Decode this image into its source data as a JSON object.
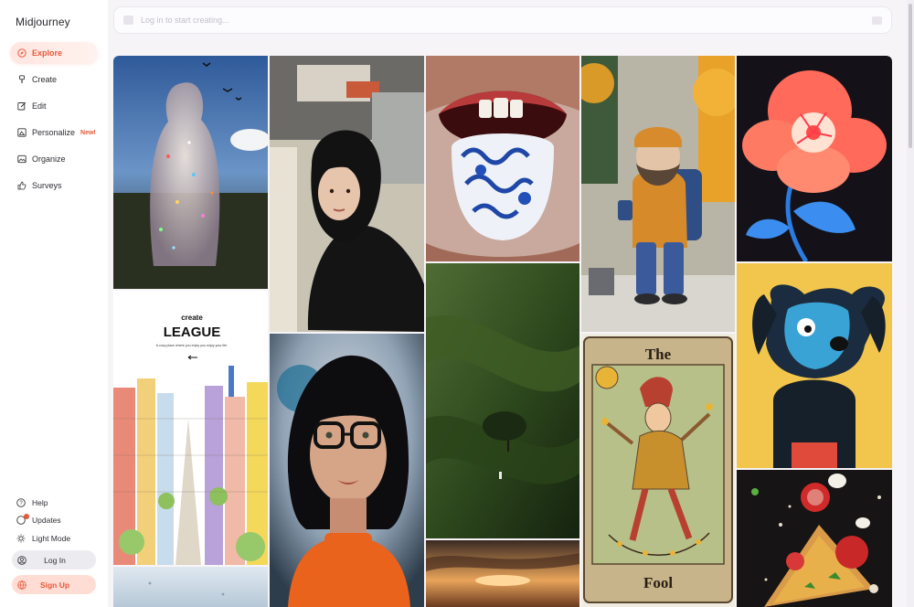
{
  "app": {
    "name": "Midjourney"
  },
  "nav": {
    "items": [
      {
        "label": "Explore",
        "icon": "compass-icon",
        "active": true
      },
      {
        "label": "Create",
        "icon": "brush-icon",
        "active": false
      },
      {
        "label": "Edit",
        "icon": "edit-icon",
        "active": false
      },
      {
        "label": "Personalize",
        "icon": "personalize-icon",
        "active": false,
        "badge": "New!"
      },
      {
        "label": "Organize",
        "icon": "image-icon",
        "active": false
      },
      {
        "label": "Surveys",
        "icon": "thumbs-up-icon",
        "active": false
      }
    ]
  },
  "footer": {
    "help": "Help",
    "updates": "Updates",
    "light_mode": "Light Mode",
    "login": "Log In",
    "signup": "Sign Up"
  },
  "search": {
    "placeholder": "Log in to start creating..."
  },
  "gallery": {
    "league_tile": {
      "create": "create",
      "league": "LEAGUE",
      "tagline": "A cozy place where you enjoy you enjoy your life."
    },
    "tarot_tile": {
      "top": "The",
      "bottom": "Fool"
    }
  },
  "colors": {
    "accent": "#e8583a",
    "background": "#f7f4f8"
  }
}
